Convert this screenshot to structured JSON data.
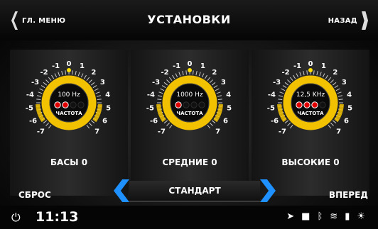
{
  "header": {
    "back_label": "ГЛ. МЕНЮ",
    "title": "УСТАНОВКИ",
    "next_label": "НАЗАД"
  },
  "dial_ticks": [
    "-7",
    "-6",
    "-5",
    "-4",
    "-3",
    "-2",
    "-1",
    "0",
    "1",
    "2",
    "3",
    "4",
    "5",
    "6",
    "7"
  ],
  "panels": [
    {
      "id": "bass",
      "freq": "100 Hz",
      "freq_label": "ЧАСТОТА",
      "name": "БАСЫ 0",
      "level": 0,
      "freq_dots": 4,
      "freq_active": 2
    },
    {
      "id": "mid",
      "freq": "1000 Hz",
      "freq_label": "ЧАСТОТА",
      "name": "СРЕДНИЕ 0",
      "level": 0,
      "freq_dots": 4,
      "freq_active": 1
    },
    {
      "id": "treble",
      "freq": "12,5 KHz",
      "freq_label": "ЧАСТОТА",
      "name": "ВЫСОКИЕ 0",
      "level": 0,
      "freq_dots": 4,
      "freq_active": 3
    }
  ],
  "footer": {
    "reset_label": "СБРОС",
    "preset_label": "СТАНДАРТ",
    "forward_label": "ВПЕРЕД"
  },
  "status": {
    "power_icon": "power-icon",
    "time": "11:13",
    "icons": [
      "navigation-icon",
      "video-icon",
      "bluetooth-icon",
      "wifi-icon",
      "signal-3g-icon",
      "brightness-icon"
    ]
  },
  "colors": {
    "accent_gold": "#f2c200",
    "dot_active": "#e00000",
    "arrow_blue": "#1e90ff"
  }
}
